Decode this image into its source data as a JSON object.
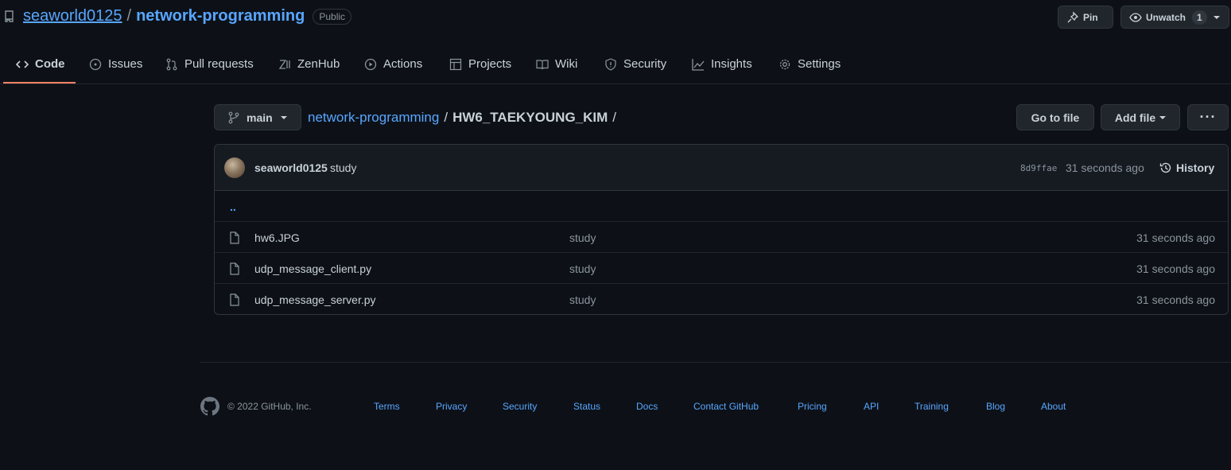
{
  "repo": {
    "owner": "seaworld0125",
    "separator": "/",
    "name": "network-programming",
    "visibility": "Public"
  },
  "header_buttons": {
    "pin_label": "Pin",
    "watch_label": "Unwatch",
    "watch_count": "1"
  },
  "tabs": [
    {
      "label": "Code",
      "icon": "code-icon"
    },
    {
      "label": "Issues",
      "icon": "issue-icon"
    },
    {
      "label": "Pull requests",
      "icon": "pull-request-icon"
    },
    {
      "label": "ZenHub",
      "icon": "zenhub-icon"
    },
    {
      "label": "Actions",
      "icon": "play-icon"
    },
    {
      "label": "Projects",
      "icon": "table-icon"
    },
    {
      "label": "Wiki",
      "icon": "book-icon"
    },
    {
      "label": "Security",
      "icon": "shield-icon"
    },
    {
      "label": "Insights",
      "icon": "graph-icon"
    },
    {
      "label": "Settings",
      "icon": "gear-icon"
    }
  ],
  "toolbar": {
    "branch": "main",
    "breadcrumb_root": "network-programming",
    "breadcrumb_sep": "/",
    "breadcrumb_current": "HW6_TAEKYOUNG_KIM",
    "breadcrumb_trailing": "/",
    "go_to_file": "Go to file",
    "add_file": "Add file",
    "more": "···"
  },
  "commit": {
    "author": "seaworld0125",
    "message": "study",
    "sha": "8d9ffae",
    "time": "31 seconds ago",
    "history_label": "History"
  },
  "parent_link": "..",
  "files": [
    {
      "name": "hw6.JPG",
      "message": "study",
      "time": "31 seconds ago"
    },
    {
      "name": "udp_message_client.py",
      "message": "study",
      "time": "31 seconds ago"
    },
    {
      "name": "udp_message_server.py",
      "message": "study",
      "time": "31 seconds ago"
    }
  ],
  "footer": {
    "copyright": "© 2022 GitHub, Inc.",
    "links": [
      "Terms",
      "Privacy",
      "Security",
      "Status",
      "Docs",
      "Contact GitHub",
      "Pricing",
      "API",
      "Training",
      "Blog",
      "About"
    ]
  },
  "colors": {
    "background": "#0d1117",
    "link": "#58a6ff",
    "active_tab_underline": "#f78166",
    "border": "#30363d"
  }
}
